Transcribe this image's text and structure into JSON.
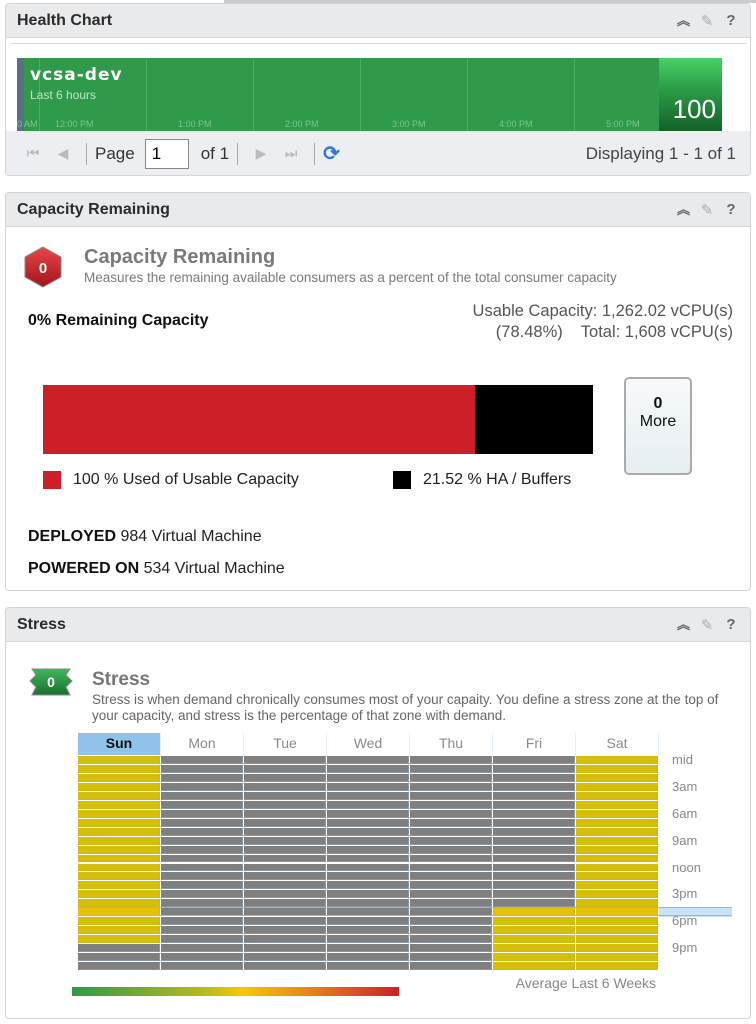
{
  "health_chart": {
    "title": "Health Chart",
    "header_icons": [
      "collapse-icon",
      "edit-pencil-icon",
      "help-icon"
    ],
    "resource_name": "vcsa-dev",
    "range_label": "Last 6 hours",
    "time_ticks": [
      "0 AM",
      "12:00 PM",
      "1:00 PM",
      "2:00 PM",
      "3:00 PM",
      "4:00 PM",
      "5:00 PM"
    ],
    "score": "100",
    "colors": {
      "healthy": "#2f9a49"
    },
    "pager": {
      "page_label": "Page",
      "page_value": "1",
      "of_label": "of 1",
      "displaying": "Displaying 1 - 1 of 1"
    }
  },
  "capacity": {
    "title": "Capacity Remaining",
    "badge_value": "0",
    "heading": "Capacity Remaining",
    "description": "Measures the remaining available consumers as a percent of the total consumer capacity",
    "remaining_label": "0% Remaining Capacity",
    "usable_line1": "Usable Capacity: 1,262.02 vCPU(s)",
    "usable_line2": "(78.48%)    Total: 1,608 vCPU(s)",
    "bar": {
      "used_pct_of_total": 78.48,
      "ha_pct_of_total": 21.52,
      "colors": {
        "used": "#cc1f27",
        "ha": "#000000"
      }
    },
    "legend": [
      {
        "label": "100 % Used of Usable Capacity",
        "color": "#cc1f27"
      },
      {
        "label": "21.52 % HA / Buffers",
        "color": "#000000"
      }
    ],
    "more_button": {
      "count": "0",
      "label": "More"
    },
    "deployed": {
      "key": "DEPLOYED",
      "value": " 984 Virtual Machine"
    },
    "powered_on": {
      "key": "POWERED ON",
      "value": " 534 Virtual Machine"
    }
  },
  "stress": {
    "title": "Stress",
    "badge_value": "0",
    "heading": "Stress",
    "description": "Stress is when demand chronically consumes most of your capaity. You define a stress zone at the top of your capacity, and stress is the percentage of that zone with demand.",
    "footer": "Average Last 6 Weeks",
    "chart_data": {
      "type": "heatmap",
      "x_categories": [
        "Sun",
        "Mon",
        "Tue",
        "Wed",
        "Thu",
        "Fri",
        "Sat"
      ],
      "selected_day": "Sun",
      "y_labels": [
        "mid",
        "3am",
        "6am",
        "9am",
        "noon",
        "3pm",
        "6pm",
        "9pm"
      ],
      "hours_per_column": 24,
      "highlighted_hour": 17,
      "legend_scale": [
        "#2f9a49",
        "#f7c800",
        "#cc1f2a"
      ],
      "colors": {
        "yellow": "#d6bf0b",
        "grey": "#7f7f7f",
        "peak": "#e8c107"
      },
      "cells": {
        "Sun": {
          "yellow_hours": [
            0,
            20
          ]
        },
        "Mon": {
          "yellow_hours": null
        },
        "Tue": {
          "yellow_hours": null
        },
        "Wed": {
          "yellow_hours": null
        },
        "Thu": {
          "yellow_hours": null
        },
        "Fri": {
          "yellow_hours": [
            17,
            23
          ]
        },
        "Sat": {
          "yellow_hours": [
            0,
            23
          ]
        }
      }
    }
  }
}
